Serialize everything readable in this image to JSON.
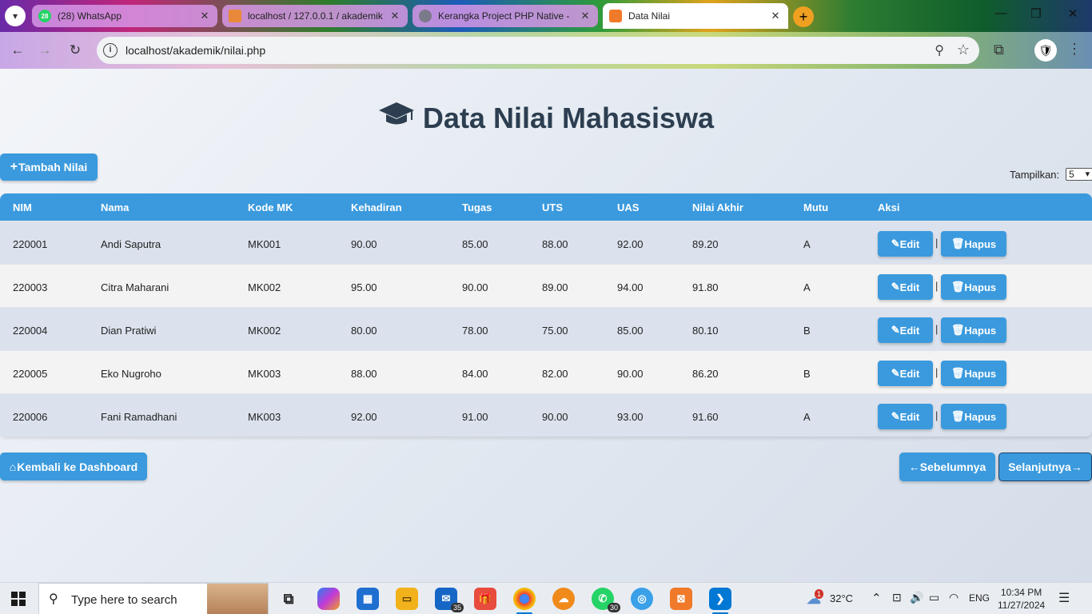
{
  "browser": {
    "tabs": [
      {
        "title": "(28) WhatsApp",
        "favicon": "whatsapp-icon",
        "active": false
      },
      {
        "title": "localhost / 127.0.0.1 / akademik",
        "favicon": "phpmyadmin-icon",
        "active": false
      },
      {
        "title": "Kerangka Project PHP Native -",
        "favicon": "globe-icon",
        "active": false
      },
      {
        "title": "Data Nilai",
        "favicon": "xampp-icon",
        "active": true
      }
    ],
    "url": "localhost/akademik/nilai.php",
    "whatsapp_badge": "28"
  },
  "page": {
    "title": "Data Nilai Mahasiswa",
    "add_button": "Tambah Nilai",
    "show_label": "Tampilkan:",
    "show_value": "5",
    "back_button": "Kembali ke Dashboard",
    "prev_button": "Sebelumnya",
    "next_button": "Selanjutnya",
    "accent_color": "#3b9ade"
  },
  "table": {
    "columns": [
      "NIM",
      "Nama",
      "Kode MK",
      "Kehadiran",
      "Tugas",
      "UTS",
      "UAS",
      "Nilai Akhir",
      "Mutu",
      "Aksi"
    ],
    "edit_label": "Edit",
    "delete_label": "Hapus",
    "separator": "|",
    "rows": [
      {
        "nim": "220001",
        "nama": "Andi Saputra",
        "kode_mk": "MK001",
        "kehadiran": "90.00",
        "tugas": "85.00",
        "uts": "88.00",
        "uas": "92.00",
        "nilai_akhir": "89.20",
        "mutu": "A"
      },
      {
        "nim": "220003",
        "nama": "Citra Maharani",
        "kode_mk": "MK002",
        "kehadiran": "95.00",
        "tugas": "90.00",
        "uts": "89.00",
        "uas": "94.00",
        "nilai_akhir": "91.80",
        "mutu": "A"
      },
      {
        "nim": "220004",
        "nama": "Dian Pratiwi",
        "kode_mk": "MK002",
        "kehadiran": "80.00",
        "tugas": "78.00",
        "uts": "75.00",
        "uas": "85.00",
        "nilai_akhir": "80.10",
        "mutu": "B"
      },
      {
        "nim": "220005",
        "nama": "Eko Nugroho",
        "kode_mk": "MK003",
        "kehadiran": "88.00",
        "tugas": "84.00",
        "uts": "82.00",
        "uas": "90.00",
        "nilai_akhir": "86.20",
        "mutu": "B"
      },
      {
        "nim": "220006",
        "nama": "Fani Ramadhani",
        "kode_mk": "MK003",
        "kehadiran": "92.00",
        "tugas": "91.00",
        "uts": "90.00",
        "uas": "93.00",
        "nilai_akhir": "91.60",
        "mutu": "A"
      }
    ]
  },
  "taskbar": {
    "search_placeholder": "Type here to search",
    "mail_badge": "35",
    "whatsapp_badge": "30",
    "weather_temp": "32°C",
    "weather_badge": "1",
    "language": "ENG",
    "time": "10:34 PM",
    "date": "11/27/2024"
  }
}
